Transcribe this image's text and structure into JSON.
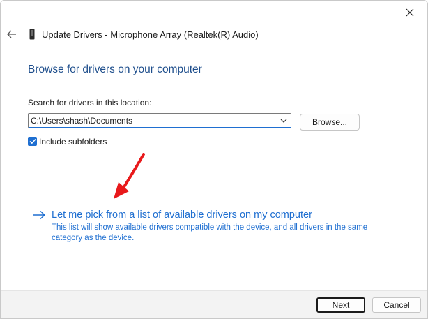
{
  "window": {
    "title": "Update Drivers - Microphone Array (Realtek(R) Audio)",
    "icons": {
      "close": "close-icon",
      "back": "back-arrow-icon",
      "device": "device-icon"
    }
  },
  "page": {
    "heading": "Browse for drivers on your computer",
    "search_label": "Search for drivers in this location:",
    "path_value": "C:\\Users\\shash\\Documents",
    "browse_label": "Browse...",
    "include_subfolders_label": "Include subfolders",
    "include_subfolders_checked": true,
    "pick_link": "Let me pick from a list of available drivers on my computer",
    "pick_description": "This list will show available drivers compatible with the device, and all drivers in the same category as the device."
  },
  "footer": {
    "next_label": "Next",
    "cancel_label": "Cancel"
  },
  "colors": {
    "accent": "#1f6fd1",
    "heading": "#1e4e8c",
    "annotation": "#e8191b"
  }
}
